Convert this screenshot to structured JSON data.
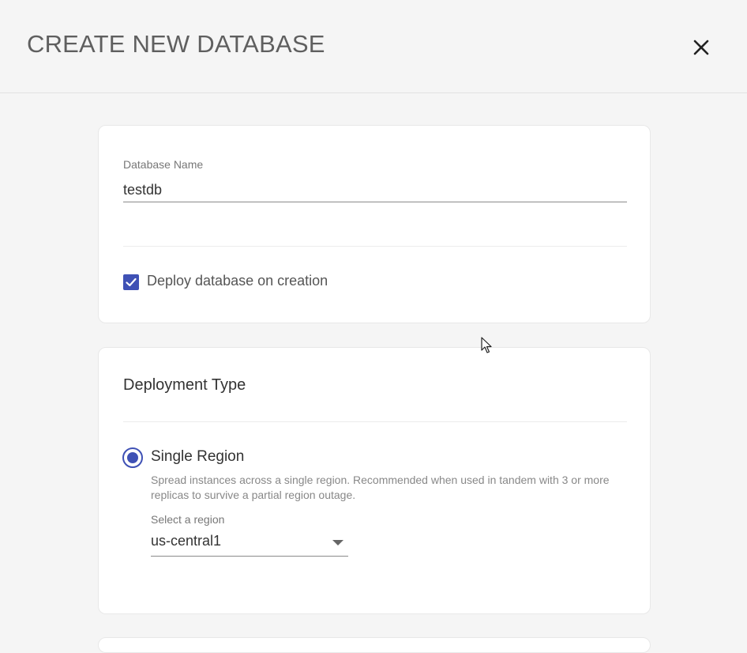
{
  "header": {
    "title": "CREATE NEW DATABASE",
    "close_icon": "close-icon"
  },
  "database_card": {
    "name_label": "Database Name",
    "name_value": "testdb",
    "deploy_checkbox": {
      "label": "Deploy database on creation",
      "checked": true
    }
  },
  "deployment_card": {
    "title": "Deployment Type",
    "options": [
      {
        "label": "Single Region",
        "selected": true,
        "description": "Spread instances across a single region. Recommended when used in tandem with 3 or more replicas to survive a partial region outage."
      }
    ],
    "region_label": "Select a region",
    "region_value": "us-central1"
  },
  "colors": {
    "accent": "#3f51b5",
    "background": "#f5f5f5",
    "card": "#ffffff"
  }
}
